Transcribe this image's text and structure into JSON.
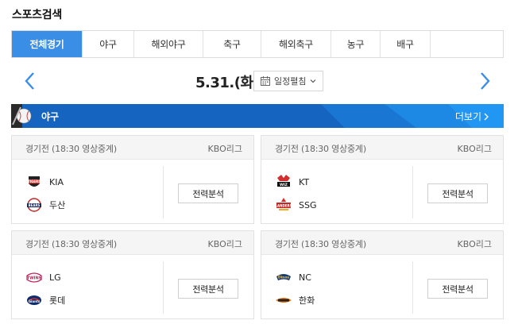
{
  "section": {
    "title": "스포츠검색"
  },
  "tabs": [
    {
      "label": "전체경기",
      "active": true
    },
    {
      "label": "야구"
    },
    {
      "label": "해외야구"
    },
    {
      "label": "축구"
    },
    {
      "label": "해외축구"
    },
    {
      "label": "농구"
    },
    {
      "label": "배구"
    },
    {
      "label": ""
    }
  ],
  "date_nav": {
    "date": "5.31.(화)",
    "schedule_label": "일정펼침",
    "prev_icon": "chevron-left-icon",
    "next_icon": "chevron-right-icon"
  },
  "sport_banner": {
    "name": "야구",
    "more_label": "더보기",
    "color": "#1565c0"
  },
  "games": [
    {
      "status": "경기전 (18:30 영상중계)",
      "league": "KBO리그",
      "teams": [
        {
          "name": "KIA",
          "logo": "kia-tigers-logo"
        },
        {
          "name": "두산",
          "logo": "doosan-bears-logo"
        }
      ],
      "button": "전력분석"
    },
    {
      "status": "경기전 (18:30 영상중계)",
      "league": "KBO리그",
      "teams": [
        {
          "name": "KT",
          "logo": "kt-wiz-logo"
        },
        {
          "name": "SSG",
          "logo": "ssg-landers-logo"
        }
      ],
      "button": "전력분석"
    },
    {
      "status": "경기전 (18:30 영상중계)",
      "league": "KBO리그",
      "teams": [
        {
          "name": "LG",
          "logo": "lg-twins-logo"
        },
        {
          "name": "롯데",
          "logo": "lotte-giants-logo"
        }
      ],
      "button": "전력분석"
    },
    {
      "status": "경기전 (18:30 영상중계)",
      "league": "KBO리그",
      "teams": [
        {
          "name": "NC",
          "logo": "nc-dinos-logo"
        },
        {
          "name": "한화",
          "logo": "hanwha-eagles-logo"
        }
      ],
      "button": "전력분석"
    }
  ],
  "colors": {
    "accent": "#3a8ee6",
    "banner": "#1565c0"
  }
}
